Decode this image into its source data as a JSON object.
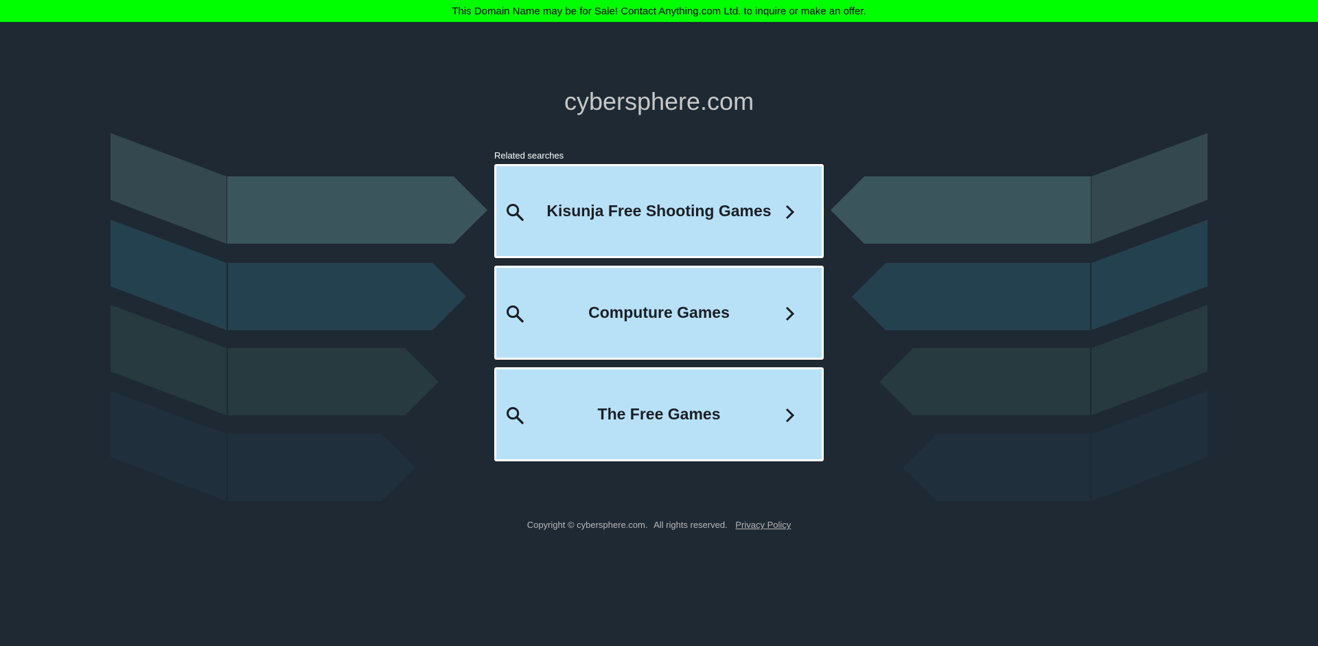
{
  "banner": {
    "text": "This Domain Name may be for Sale! Contact Anything.com Ltd. to inquire or make an offer."
  },
  "domain": "cybersphere.com",
  "related_searches": {
    "label": "Related searches",
    "items": [
      {
        "label": "Kisunja Free Shooting Games",
        "icon": "search-icon",
        "arrow": "chevron-right-icon"
      },
      {
        "label": "Computure Games",
        "icon": "search-icon",
        "arrow": "chevron-right-icon"
      },
      {
        "label": "The Free Games",
        "icon": "search-icon",
        "arrow": "chevron-right-icon"
      }
    ]
  },
  "footer": {
    "copyright": "Copyright © cybersphere.com.",
    "rights": "All rights reserved.",
    "privacy_link": "Privacy Policy"
  },
  "colors": {
    "background": "#1e2933",
    "banner": "#00ff00",
    "search_box": "#b8e1f8",
    "arrow_row_1": "#3b555c",
    "arrow_row_2": "#24414f",
    "arrow_row_3": "#273a40",
    "arrow_row_4": "#1f2f3b"
  }
}
